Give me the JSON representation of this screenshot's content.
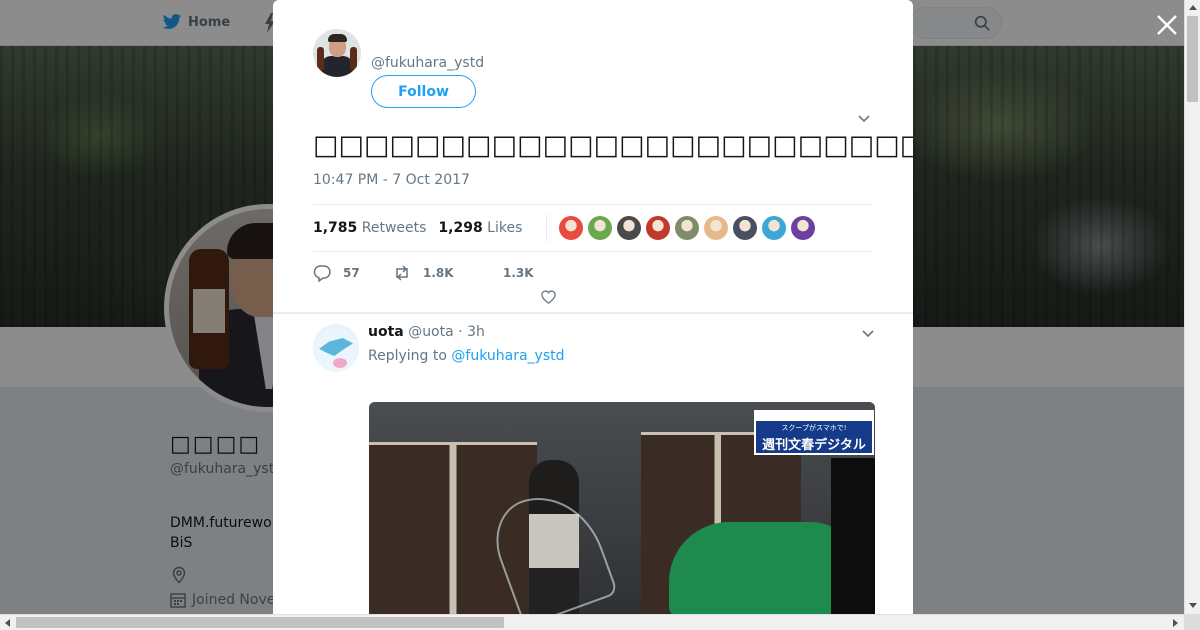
{
  "nav": {
    "home_label": "Home"
  },
  "profile": {
    "name": "□□□□",
    "handle": "@fukuhara_yst",
    "bio_line1": "DMM.futurewo",
    "bio_line2": "BiS",
    "joined": "Joined Nove"
  },
  "tweet": {
    "handle": "@fukuhara_ystd",
    "follow_label": "Follow",
    "text": "□□□□□□□□□□□□□□□□□□□□□□□□□□□□□□□□□□□□□□□□□□□□□□□□□□□□□",
    "timestamp": "10:47 PM - 7 Oct 2017",
    "retweets_count": "1,785",
    "retweets_label": "Retweets",
    "likes_count": "1,298",
    "likes_label": "Likes",
    "liker_colors": [
      "#e74c3c",
      "#6aa84f",
      "#4a4a4a",
      "#c0392b",
      "#7f8c6a",
      "#e6b98c",
      "#4b4f63",
      "#3fa7d6",
      "#6c3fa0"
    ],
    "reply_count": "57",
    "retweet_count_short": "1.8K",
    "like_count_short": "1.3K"
  },
  "reply": {
    "name": "uota",
    "handle": "@uota",
    "time": "3h",
    "replying_prefix": "Replying to",
    "replying_to": "@fukuhara_ystd",
    "media_logo_sub": "スクープがスマホで!",
    "media_logo_main": "週刊文春デジタル"
  }
}
